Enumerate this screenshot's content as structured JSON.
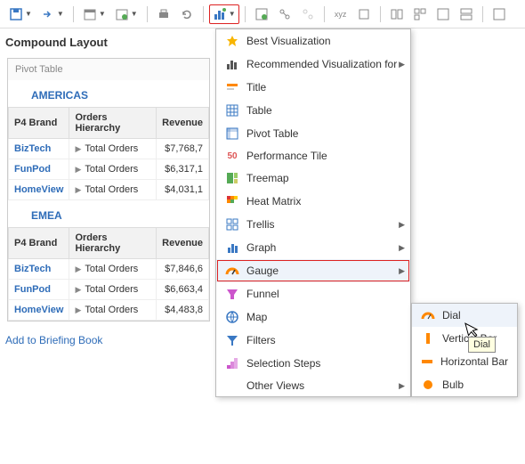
{
  "page_title": "Compound Layout",
  "panel_header": "Pivot Table",
  "regions": [
    {
      "name": "AMERICAS",
      "headers": [
        "P4 Brand",
        "Orders Hierarchy",
        "Revenue"
      ],
      "rows": [
        {
          "brand": "BizTech",
          "orders": "Total Orders",
          "revenue": "$7,768,7"
        },
        {
          "brand": "FunPod",
          "orders": "Total Orders",
          "revenue": "$6,317,1"
        },
        {
          "brand": "HomeView",
          "orders": "Total Orders",
          "revenue": "$4,031,1"
        }
      ]
    },
    {
      "name": "EMEA",
      "headers": [
        "P4 Brand",
        "Orders Hierarchy",
        "Revenue"
      ],
      "rows": [
        {
          "brand": "BizTech",
          "orders": "Total Orders",
          "revenue": "$7,846,6"
        },
        {
          "brand": "FunPod",
          "orders": "Total Orders",
          "revenue": "$6,663,4"
        },
        {
          "brand": "HomeView",
          "orders": "Total Orders",
          "revenue": "$4,483,8"
        }
      ]
    }
  ],
  "briefing_link": "Add to Briefing Book",
  "menu1": {
    "items": [
      {
        "label": "Best Visualization",
        "icon": "star",
        "sub": false
      },
      {
        "label": "Recommended Visualization for",
        "icon": "bars",
        "sub": true
      },
      {
        "label": "Title",
        "icon": "title",
        "sub": false
      },
      {
        "label": "Table",
        "icon": "table",
        "sub": false
      },
      {
        "label": "Pivot Table",
        "icon": "pivot",
        "sub": false
      },
      {
        "label": "Performance Tile",
        "icon": "tile",
        "sub": false
      },
      {
        "label": "Treemap",
        "icon": "treemap",
        "sub": false
      },
      {
        "label": "Heat Matrix",
        "icon": "heat",
        "sub": false
      },
      {
        "label": "Trellis",
        "icon": "trellis",
        "sub": true
      },
      {
        "label": "Graph",
        "icon": "graph",
        "sub": true
      },
      {
        "label": "Gauge",
        "icon": "gauge",
        "sub": true,
        "boxed": true,
        "sel": true
      },
      {
        "label": "Funnel",
        "icon": "funnel",
        "sub": false
      },
      {
        "label": "Map",
        "icon": "map",
        "sub": false
      },
      {
        "label": "Filters",
        "icon": "filter",
        "sub": false
      },
      {
        "label": "Selection Steps",
        "icon": "steps",
        "sub": false
      },
      {
        "label": "Other Views",
        "icon": "",
        "sub": true
      }
    ]
  },
  "menu2": {
    "items": [
      {
        "label": "Dial",
        "icon": "dial",
        "sel": true
      },
      {
        "label": "Vertical Bar",
        "icon": "vbar"
      },
      {
        "label": "Horizontal Bar",
        "icon": "hbar"
      },
      {
        "label": "Bulb",
        "icon": "bulb"
      }
    ]
  },
  "tooltip": "Dial"
}
